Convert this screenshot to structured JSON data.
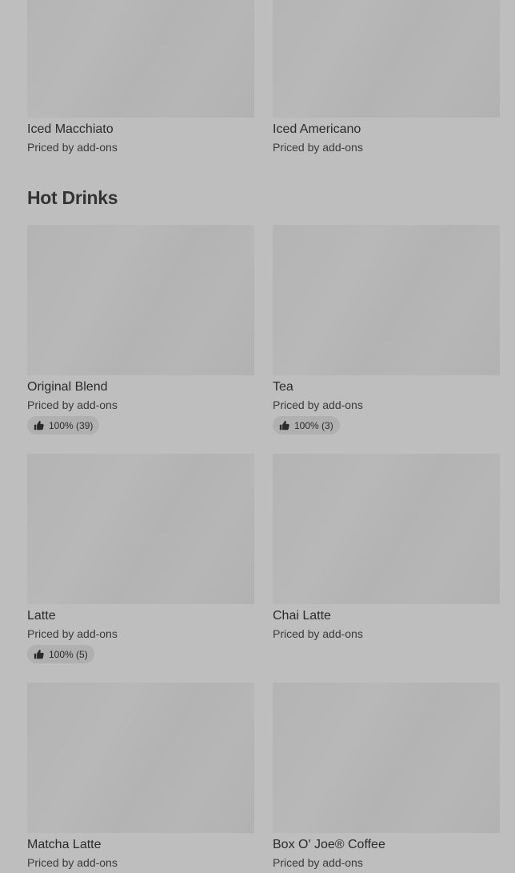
{
  "section": {
    "title": "Hot Drinks"
  },
  "cards": {
    "iced_macchiato": {
      "name": "Iced Macchiato",
      "price": "Priced by add-ons"
    },
    "iced_americano": {
      "name": "Iced Americano",
      "price": "Priced by add-ons"
    },
    "original_blend": {
      "name": "Original Blend",
      "price": "Priced by add-ons",
      "rating": "100% (39)"
    },
    "tea": {
      "name": "Tea",
      "price": "Priced by add-ons",
      "rating": "100% (3)"
    },
    "latte": {
      "name": "Latte",
      "price": "Priced by add-ons",
      "rating": "100% (5)"
    },
    "chai_latte": {
      "name": "Chai Latte",
      "price": "Priced by add-ons"
    },
    "matcha_latte": {
      "name": "Matcha Latte",
      "price": "Priced by add-ons"
    },
    "box_o_joe": {
      "name": "Box O' Joe® Coffee",
      "price": "Priced by add-ons"
    }
  },
  "icons": {
    "rating": "thumbs-up-icon"
  },
  "colors": {
    "background": "#bebebe",
    "placeholder": "#b4b4b4",
    "pill": "#b0b0b0"
  }
}
